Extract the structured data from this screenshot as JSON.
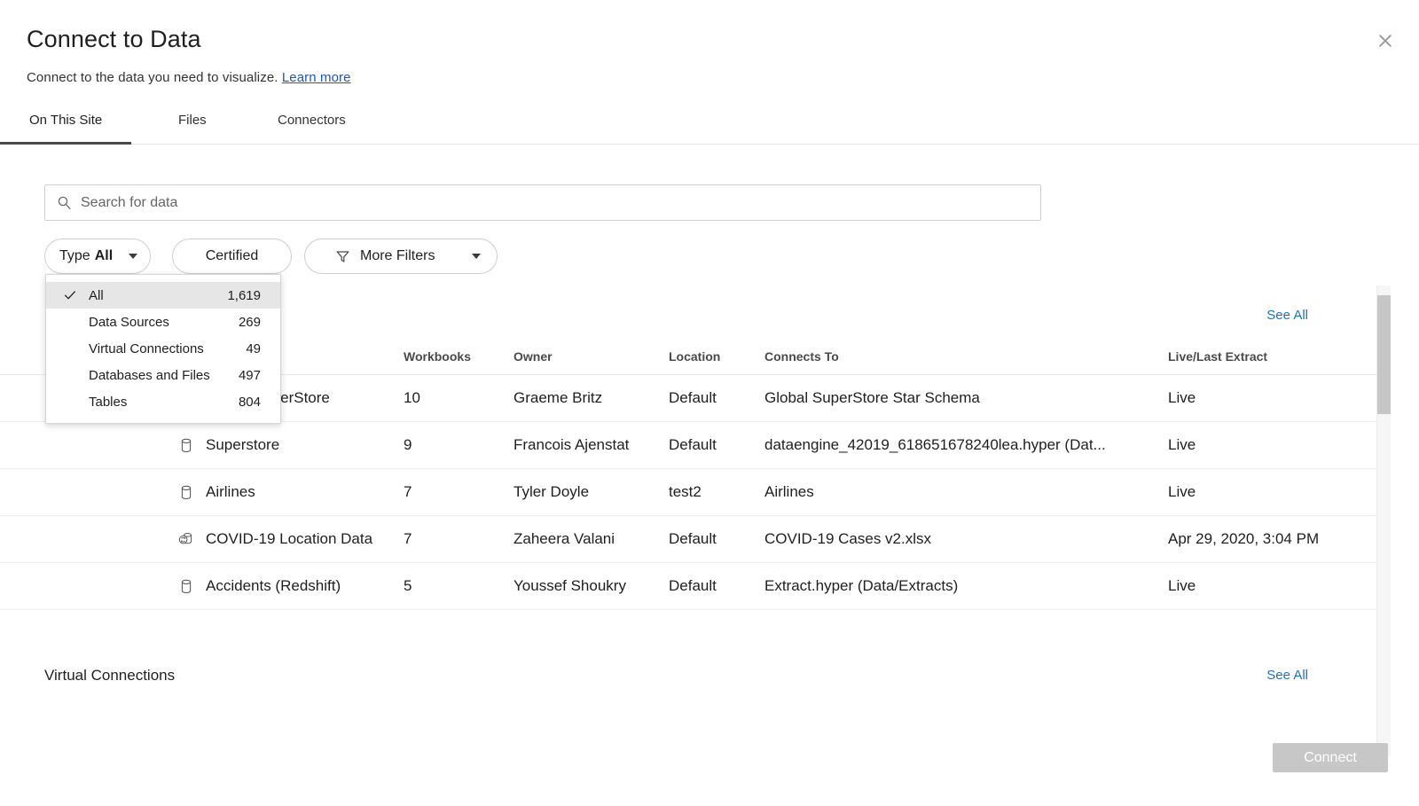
{
  "header": {
    "title": "Connect to Data",
    "subtitle_text": "Connect to the data you need to visualize.",
    "learn_more": "Learn more",
    "close_icon": "close-icon"
  },
  "tabs": [
    {
      "label": "On This Site",
      "active": true
    },
    {
      "label": "Files",
      "active": false
    },
    {
      "label": "Connectors",
      "active": false
    }
  ],
  "search": {
    "placeholder": "Search for data",
    "value": "",
    "icon": "search-icon"
  },
  "filters": {
    "type": {
      "label": "Type",
      "value": "All",
      "icon": "chevron-down-icon"
    },
    "certified": {
      "label": "Certified"
    },
    "more_filters": {
      "label": "More Filters",
      "icon": "funnel-icon",
      "caret": "chevron-down-icon"
    }
  },
  "type_dropdown": {
    "items": [
      {
        "label": "All",
        "count": "1,619",
        "selected": true
      },
      {
        "label": "Data Sources",
        "count": "269",
        "selected": false
      },
      {
        "label": "Virtual Connections",
        "count": "49",
        "selected": false
      },
      {
        "label": "Databases and Files",
        "count": "497",
        "selected": false
      },
      {
        "label": "Tables",
        "count": "804",
        "selected": false
      }
    ],
    "check_icon": "check-icon"
  },
  "results": {
    "see_all": "See All",
    "columns": [
      "",
      "Workbooks",
      "Owner",
      "Location",
      "Connects To",
      "Live/Last Extract"
    ],
    "rows": [
      {
        "name": "Global SuperStore",
        "icon": "database-icon",
        "workbooks": "10",
        "owner": "Graeme Britz",
        "location": "Default",
        "connects_to": "Global SuperStore Star Schema",
        "live": "Live"
      },
      {
        "name": "Superstore",
        "icon": "database-icon",
        "workbooks": "9",
        "owner": "Francois Ajenstat",
        "location": "Default",
        "connects_to": "dataengine_42019_618651678240lea.hyper (Dat...",
        "live": "Live"
      },
      {
        "name": "Airlines",
        "icon": "database-icon",
        "workbooks": "7",
        "owner": "Tyler Doyle",
        "location": "test2",
        "connects_to": "Airlines",
        "live": "Live"
      },
      {
        "name": "COVID-19 Location Data",
        "icon": "extract-refresh-icon",
        "workbooks": "7",
        "owner": "Zaheera Valani",
        "location": "Default",
        "connects_to": "COVID-19 Cases v2.xlsx",
        "live": "Apr 29, 2020, 3:04 PM"
      },
      {
        "name": "Accidents (Redshift)",
        "icon": "database-icon",
        "workbooks": "5",
        "owner": "Youssef Shoukry",
        "location": "Default",
        "connects_to": "Extract.hyper (Data/Extracts)",
        "live": "Live"
      }
    ]
  },
  "virtual_connections": {
    "title": "Virtual Connections",
    "see_all": "See All"
  },
  "footer": {
    "connect_label": "Connect"
  },
  "colors": {
    "link": "#1f6fc4",
    "learn_more_link": "#1f57c3",
    "active_tab_underline": "#4a4a4a",
    "dropdown_selected_bg": "#e6e6e6",
    "connect_disabled_bg": "#c7c7c7",
    "scrollbar_thumb": "#c6c6c6"
  }
}
